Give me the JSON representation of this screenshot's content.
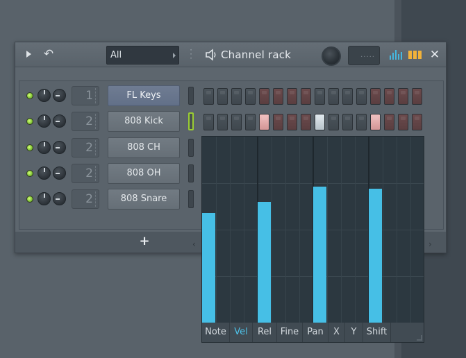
{
  "window": {
    "title": "Channel rack",
    "filter_value": "All",
    "icons": {
      "play": "play-icon",
      "undo": "undo-icon",
      "speaker": "speaker-icon",
      "graph": "graph-editor-icon",
      "pattern": "step-sequencer-icon",
      "close": "close-icon"
    }
  },
  "channels": [
    {
      "mixer_track": "1",
      "name": "FL Keys",
      "selected": true
    },
    {
      "mixer_track": "2",
      "name": "808 Kick",
      "selected": false
    },
    {
      "mixer_track": "2",
      "name": "808 CH",
      "selected": false
    },
    {
      "mixer_track": "2",
      "name": "808 OH",
      "selected": false
    },
    {
      "mixer_track": "2",
      "name": "808 Snare",
      "selected": false
    }
  ],
  "step_rows": {
    "row1": [
      0,
      0,
      0,
      0,
      0,
      0,
      0,
      0,
      0,
      0,
      0,
      0,
      0,
      0,
      0,
      0
    ],
    "row2": [
      0,
      0,
      0,
      0,
      1,
      0,
      0,
      0,
      1,
      0,
      0,
      0,
      1,
      0,
      0,
      0
    ]
  },
  "footer": {
    "add_label": "+"
  },
  "graph_editor": {
    "tabs": [
      "Note",
      "Vel",
      "Rel",
      "Fine",
      "Pan",
      "X",
      "Y",
      "Shift"
    ],
    "active_tab": "Vel",
    "velocity_values": [
      0.59,
      0.65,
      0.73,
      0.72
    ]
  },
  "colors": {
    "led": "#86c83a",
    "velocity_bar": "#46bfe6",
    "active_tab": "#4ec3ea",
    "selected_channel": "#627088",
    "step_pink_on": "#f1c0c0"
  }
}
